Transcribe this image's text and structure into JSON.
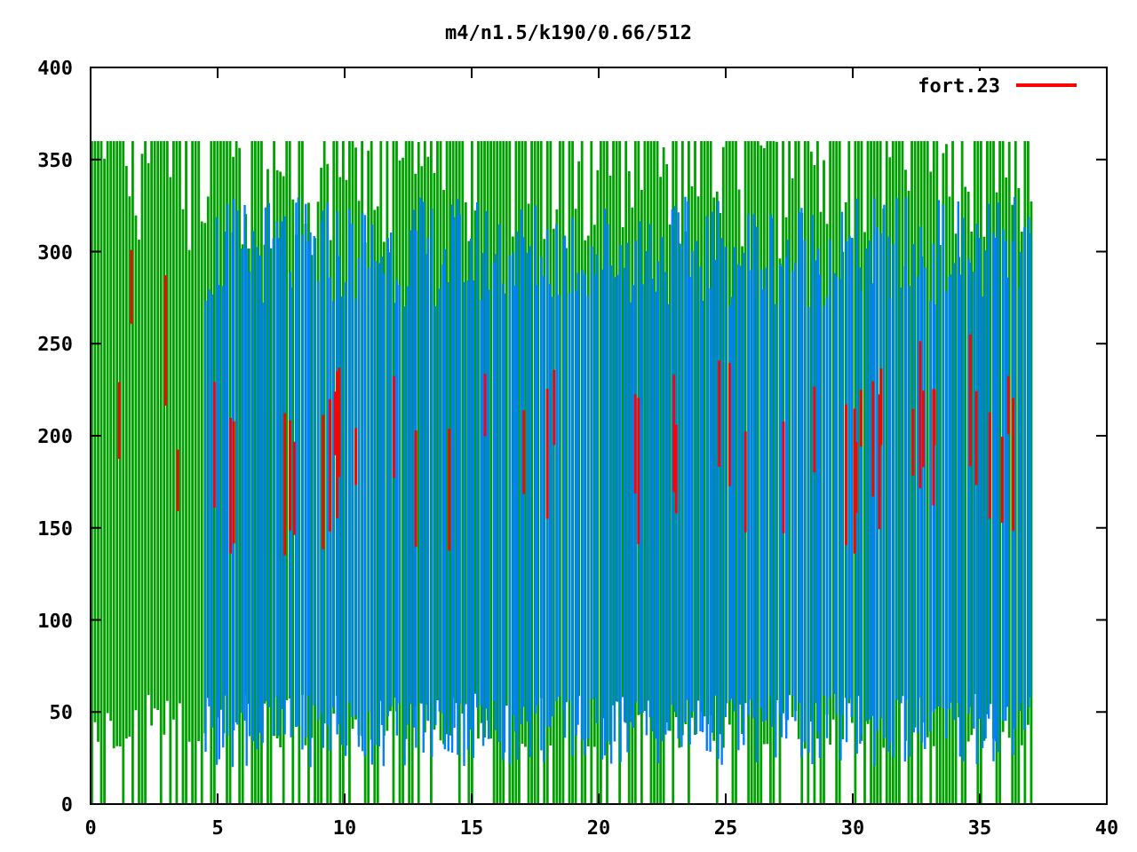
{
  "plot": {
    "title": "m4/n1.5/k190/0.66/512",
    "legend": {
      "label": "fort.23",
      "color": "#ff0000"
    },
    "xticks": [
      "0",
      "5",
      "10",
      "15",
      "20",
      "25",
      "30",
      "35",
      "40"
    ],
    "yticks": [
      "400",
      "350",
      "300",
      "250",
      "200",
      "150",
      "100",
      "50",
      "0"
    ]
  }
}
